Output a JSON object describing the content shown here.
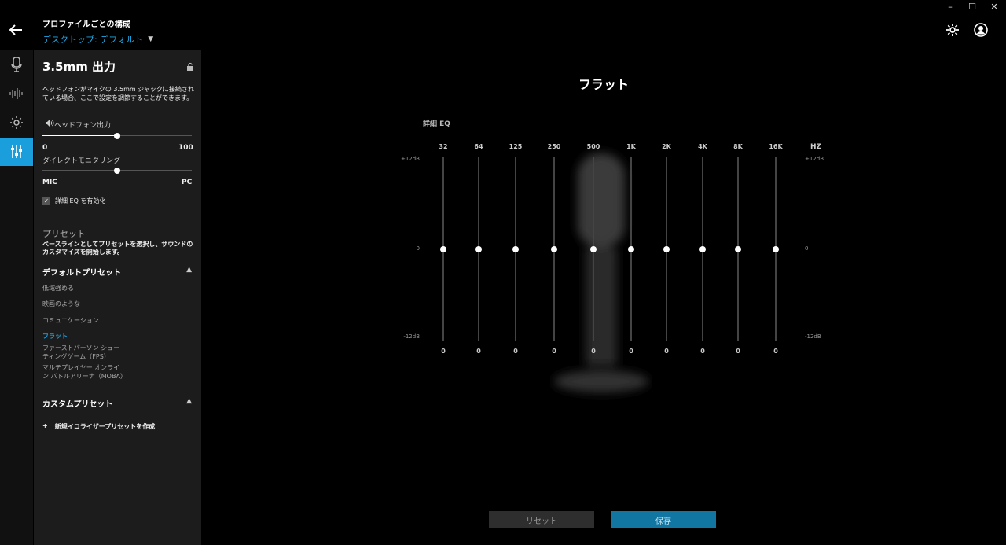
{
  "header": {
    "profile_heading": "プロファイルごとの構成",
    "profile_value": "デスクトップ: デフォルト"
  },
  "panel": {
    "title": "3.5mm 出力",
    "description": "ヘッドフォンがマイクの 3.5mm ジャックに接続されている場合、ここで設定を調節することができます。",
    "headphone_output_label": "ヘッドフォン出力",
    "headphone_output_value": 50,
    "range_min": "0",
    "range_max": "100",
    "direct_monitoring_label": "ダイレクトモニタリング",
    "direct_monitoring_value": 50,
    "dm_left": "MIC",
    "dm_right": "PC",
    "advanced_eq_checkbox_label": "詳細 EQ を有効化",
    "advanced_eq_checked": true,
    "presets_heading": "プリセット",
    "presets_description": "ベースラインとしてプリセットを選択し、サウンドのカスタマイズを開始します。",
    "default_presets_heading": "デフォルトプリセット",
    "default_presets": [
      "低域強める",
      "映画のような",
      "コミュニケーション",
      "フラット",
      "ファーストパーソン シューティングゲーム（FPS）",
      "マルチプレイヤー オンライン バトルアリーナ（MOBA）"
    ],
    "selected_preset": "フラット",
    "custom_presets_heading": "カスタムプリセット",
    "add_preset_label": "新規イコライザープリセットを作成"
  },
  "main": {
    "title": "フラット",
    "eq_label": "詳細 EQ",
    "hz_label": "HZ",
    "db_top": "+12dB",
    "db_mid": "0",
    "db_bottom": "-12dB",
    "bands": [
      {
        "freq": "32",
        "value": 0
      },
      {
        "freq": "64",
        "value": 0
      },
      {
        "freq": "125",
        "value": 0
      },
      {
        "freq": "250",
        "value": 0
      },
      {
        "freq": "500",
        "value": 0
      },
      {
        "freq": "1K",
        "value": 0
      },
      {
        "freq": "2K",
        "value": 0
      },
      {
        "freq": "4K",
        "value": 0
      },
      {
        "freq": "8K",
        "value": 0
      },
      {
        "freq": "16K",
        "value": 0
      }
    ],
    "reset_label": "リセット",
    "save_label": "保存"
  },
  "colors": {
    "accent": "#1a9fdc",
    "save_button": "#1276a3",
    "panel_bg": "#1c1c1c"
  },
  "icons": [
    "back-arrow-icon",
    "gear-icon",
    "account-icon",
    "microphone-icon",
    "waveform-icon",
    "brightness-icon",
    "equalizer-icon",
    "lock-icon",
    "speaker-icon",
    "plus-icon"
  ]
}
